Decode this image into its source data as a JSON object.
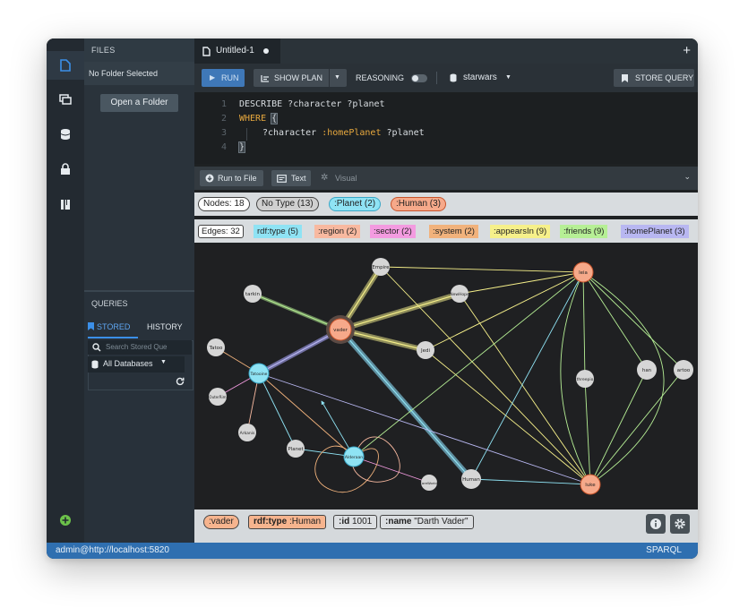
{
  "sidebar": {
    "icons": [
      "file-icon",
      "stack-icon",
      "database-icon",
      "lock-icon",
      "book-icon"
    ],
    "bottom_icon": "plus-circle-icon"
  },
  "files": {
    "header": "FILES",
    "no_folder": "No Folder Selected",
    "open_folder": "Open a Folder"
  },
  "queries": {
    "header": "QUERIES",
    "tabs": [
      "STORED",
      "HISTORY"
    ],
    "search_placeholder": "Search Stored Que",
    "database": "All Databases"
  },
  "tabs": {
    "name": "Untitled-1",
    "new": "+"
  },
  "toolbar": {
    "run": "RUN",
    "show_plan": "SHOW PLAN",
    "reasoning": "REASONING",
    "database": "starwars",
    "store_query": "STORE QUERY"
  },
  "editor": {
    "line_numbers": [
      "1",
      "2",
      "3",
      "4"
    ],
    "lines": {
      "l1": "DESCRIBE ?character ?planet",
      "l2_kw": "WHERE",
      "l2_brace": "{",
      "l3_var1": "?character",
      "l3_pred": ":homePlanet",
      "l3_var2": "?planet",
      "l4_brace": "}"
    }
  },
  "results": {
    "run_to_file": "Run to File",
    "text": "Text",
    "visual": "Visual"
  },
  "filters": {
    "nodes": [
      {
        "label": "Nodes: 18",
        "bg": "#ffffff",
        "border": "#444444"
      },
      {
        "label": "No Type (13)",
        "bg": "#d0d0d0",
        "border": "#444444"
      },
      {
        "label": ":Planet (2)",
        "bg": "#8fe3f4",
        "border": "#3aa7c7"
      },
      {
        "label": ":Human (3)",
        "bg": "#f6a98a",
        "border": "#c8542b"
      }
    ],
    "edges": [
      {
        "label": "Edges: 32",
        "bg": "#ffffff",
        "border": "#444444"
      },
      {
        "label": "rdf:type (5)",
        "bg": "#8fe3f4",
        "border": "#8fe3f4"
      },
      {
        "label": ":region (2)",
        "bg": "#f8b9a0",
        "border": "#f8b9a0"
      },
      {
        "label": ":sector (2)",
        "bg": "#f39be0",
        "border": "#f39be0"
      },
      {
        "label": ":system (2)",
        "bg": "#f1b27c",
        "border": "#f1b27c"
      },
      {
        "label": ":appearsIn (9)",
        "bg": "#f6f08a",
        "border": "#f6f08a"
      },
      {
        "label": ":friends (9)",
        "bg": "#b6ef95",
        "border": "#b6ef95"
      },
      {
        "label": ":homePlanet (3)",
        "bg": "#b8b7f1",
        "border": "#b8b7f1"
      }
    ]
  },
  "graph": {
    "nodes": {
      "empire": "Empire",
      "tarkin": "tarkin",
      "vader": "vader",
      "newhope": "NewHope",
      "leia": "leia",
      "tatoo": "Tatoo",
      "tatooine": "Tatooine",
      "jedi": "Jedi",
      "outerrim": "OuterRim",
      "han": "han",
      "artoo": "artoo",
      "threepio": "threepio",
      "arkanis": "Arkanis",
      "planet": "Planet",
      "alderaan": "Alderaan",
      "luke": "luke",
      "human": "Human",
      "coremlds": "CoreWorlds"
    }
  },
  "footer": {
    "vader": ":vader",
    "type_key": "rdf:type",
    "type_val": ":Human",
    "id_key": ":id",
    "id_val": "1001",
    "name_key": ":name",
    "name_val": "\"Darth Vader\""
  },
  "status": {
    "user": "admin@http://localhost:5820",
    "lang": "SPARQL"
  }
}
